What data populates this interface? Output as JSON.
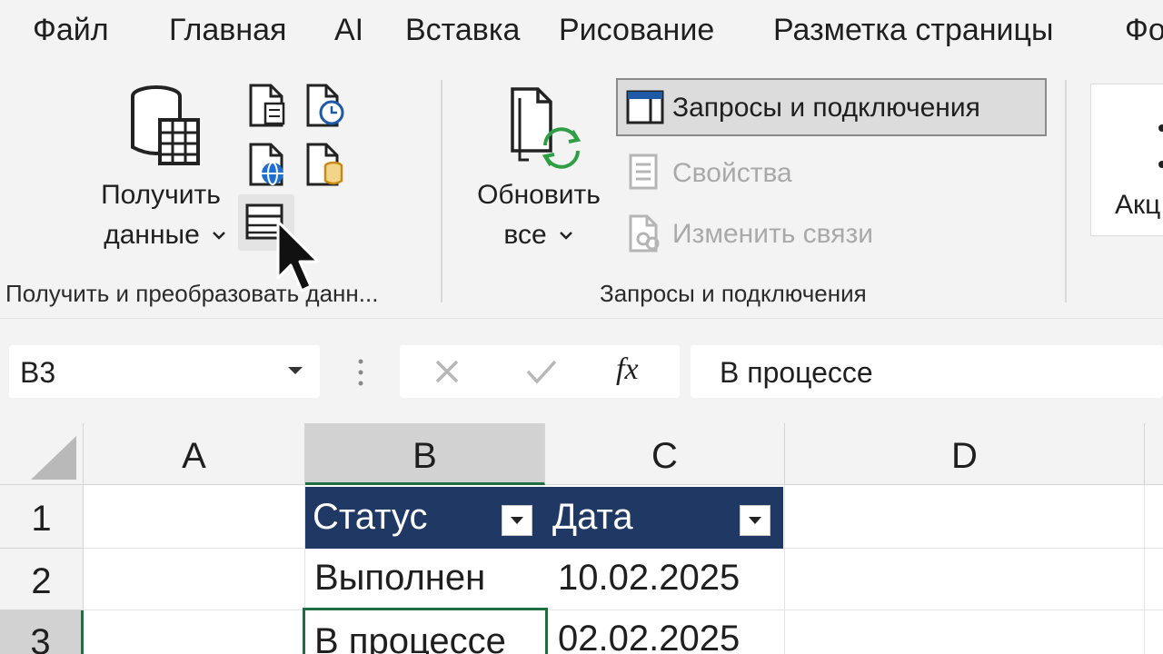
{
  "ribbon_tabs": [
    "Файл",
    "Главная",
    "AI",
    "Вставка",
    "Рисование",
    "Разметка страницы",
    "Фо"
  ],
  "get_data_group": {
    "get_data_label_line1": "Получить",
    "get_data_label_line2": "данные",
    "group_label": "Получить и преобразовать данн..."
  },
  "queries_group": {
    "refresh_label_line1": "Обновить",
    "refresh_label_line2": "все",
    "queries_button": "Запросы и подключения",
    "properties_button": "Свойства",
    "edit_links_button": "Изменить связи",
    "group_label": "Запросы и подключения"
  },
  "next_group": {
    "partial_label": "Акц"
  },
  "formula_bar": {
    "name_box": "B3",
    "fx_label": "fx",
    "formula_value": "В процессе"
  },
  "sheet": {
    "columns": [
      "A",
      "B",
      "C",
      "D"
    ],
    "rows": [
      "1",
      "2",
      "3"
    ],
    "table_headers": [
      "Статус",
      "Дата"
    ],
    "row2": [
      "Выполнен",
      "10.02.2025"
    ],
    "row3": [
      "В процессе",
      "02.02.2025"
    ]
  },
  "colors": {
    "table_header": "#1f3864",
    "selection": "#1e6e42",
    "ribbon_bg": "#f3f3f3"
  }
}
